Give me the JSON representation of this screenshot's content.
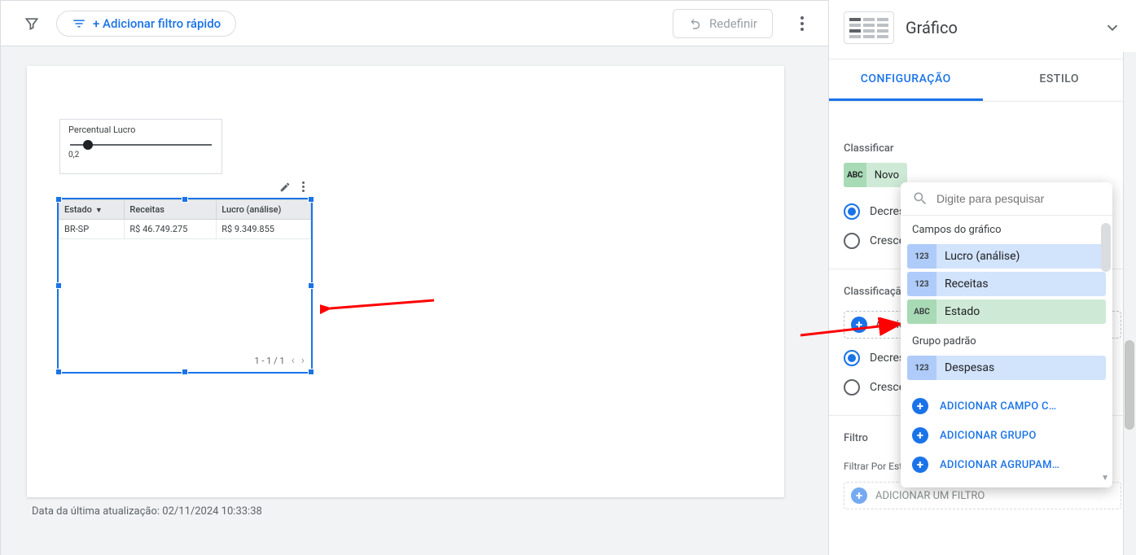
{
  "toolbar": {
    "quick_filter_label": "+ Adicionar filtro rápido",
    "redefine_label": "Redefinir"
  },
  "slider": {
    "title": "Percentual Lucro",
    "value": "0,2"
  },
  "table": {
    "headers": [
      "Estado",
      "Receitas",
      "Lucro (análise)"
    ],
    "rows": [
      {
        "estado": "BR-SP",
        "receitas": "R$ 46.749.275",
        "lucro": "R$ 9.349.855"
      }
    ],
    "pager": "1 - 1 / 1"
  },
  "footer": "Data da última atualização: 02/11/2024 10:33:38",
  "side": {
    "title": "Gráfico",
    "tab_config": "CONFIGURAÇÃO",
    "tab_style": "ESTILO",
    "sort_label": "Classificar",
    "novo_chip_label": "Novo",
    "decrescente": "Decrescente",
    "crescente": "Crescente",
    "classificacao_sec": "Classificação secundária",
    "add_label": "Adicionar dimensão",
    "filtro_label": "Filtro",
    "filtrar_por": "Filtrar Por Este Chart",
    "add_filtro": "ADICIONAR UM FILTRO"
  },
  "popup": {
    "search_placeholder": "Digite para pesquisar",
    "group1": "Campos do gráfico",
    "group2": "Grupo padrão",
    "fields": [
      {
        "type": "123",
        "kind": "metric",
        "label": "Lucro (análise)"
      },
      {
        "type": "123",
        "kind": "metric",
        "label": "Receitas"
      },
      {
        "type": "ABC",
        "kind": "dimension",
        "label": "Estado"
      }
    ],
    "fields2": [
      {
        "type": "123",
        "kind": "metric",
        "label": "Despesas"
      }
    ],
    "action1": "ADICIONAR CAMPO C…",
    "action2": "ADICIONAR GRUPO",
    "action3": "ADICIONAR AGRUPAM…"
  },
  "chart_data": {
    "type": "table",
    "columns": [
      "Estado",
      "Receitas",
      "Lucro (análise)"
    ],
    "rows": [
      [
        "BR-SP",
        46749275,
        9349855
      ]
    ],
    "currency": "R$"
  }
}
